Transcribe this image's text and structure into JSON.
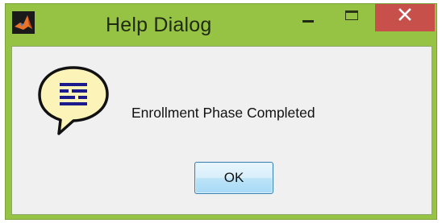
{
  "window": {
    "title": "Help Dialog",
    "app_icon": "matlab-logo-icon",
    "controls": {
      "minimize_icon": "minimize-icon",
      "maximize_icon": "maximize-icon",
      "close_icon": "close-icon",
      "close_color": "#c7504a"
    },
    "frame_color": "#97c344"
  },
  "dialog": {
    "icon": "help-speech-bubble-icon",
    "message": "Enrollment Phase Completed",
    "ok_label": "OK"
  }
}
